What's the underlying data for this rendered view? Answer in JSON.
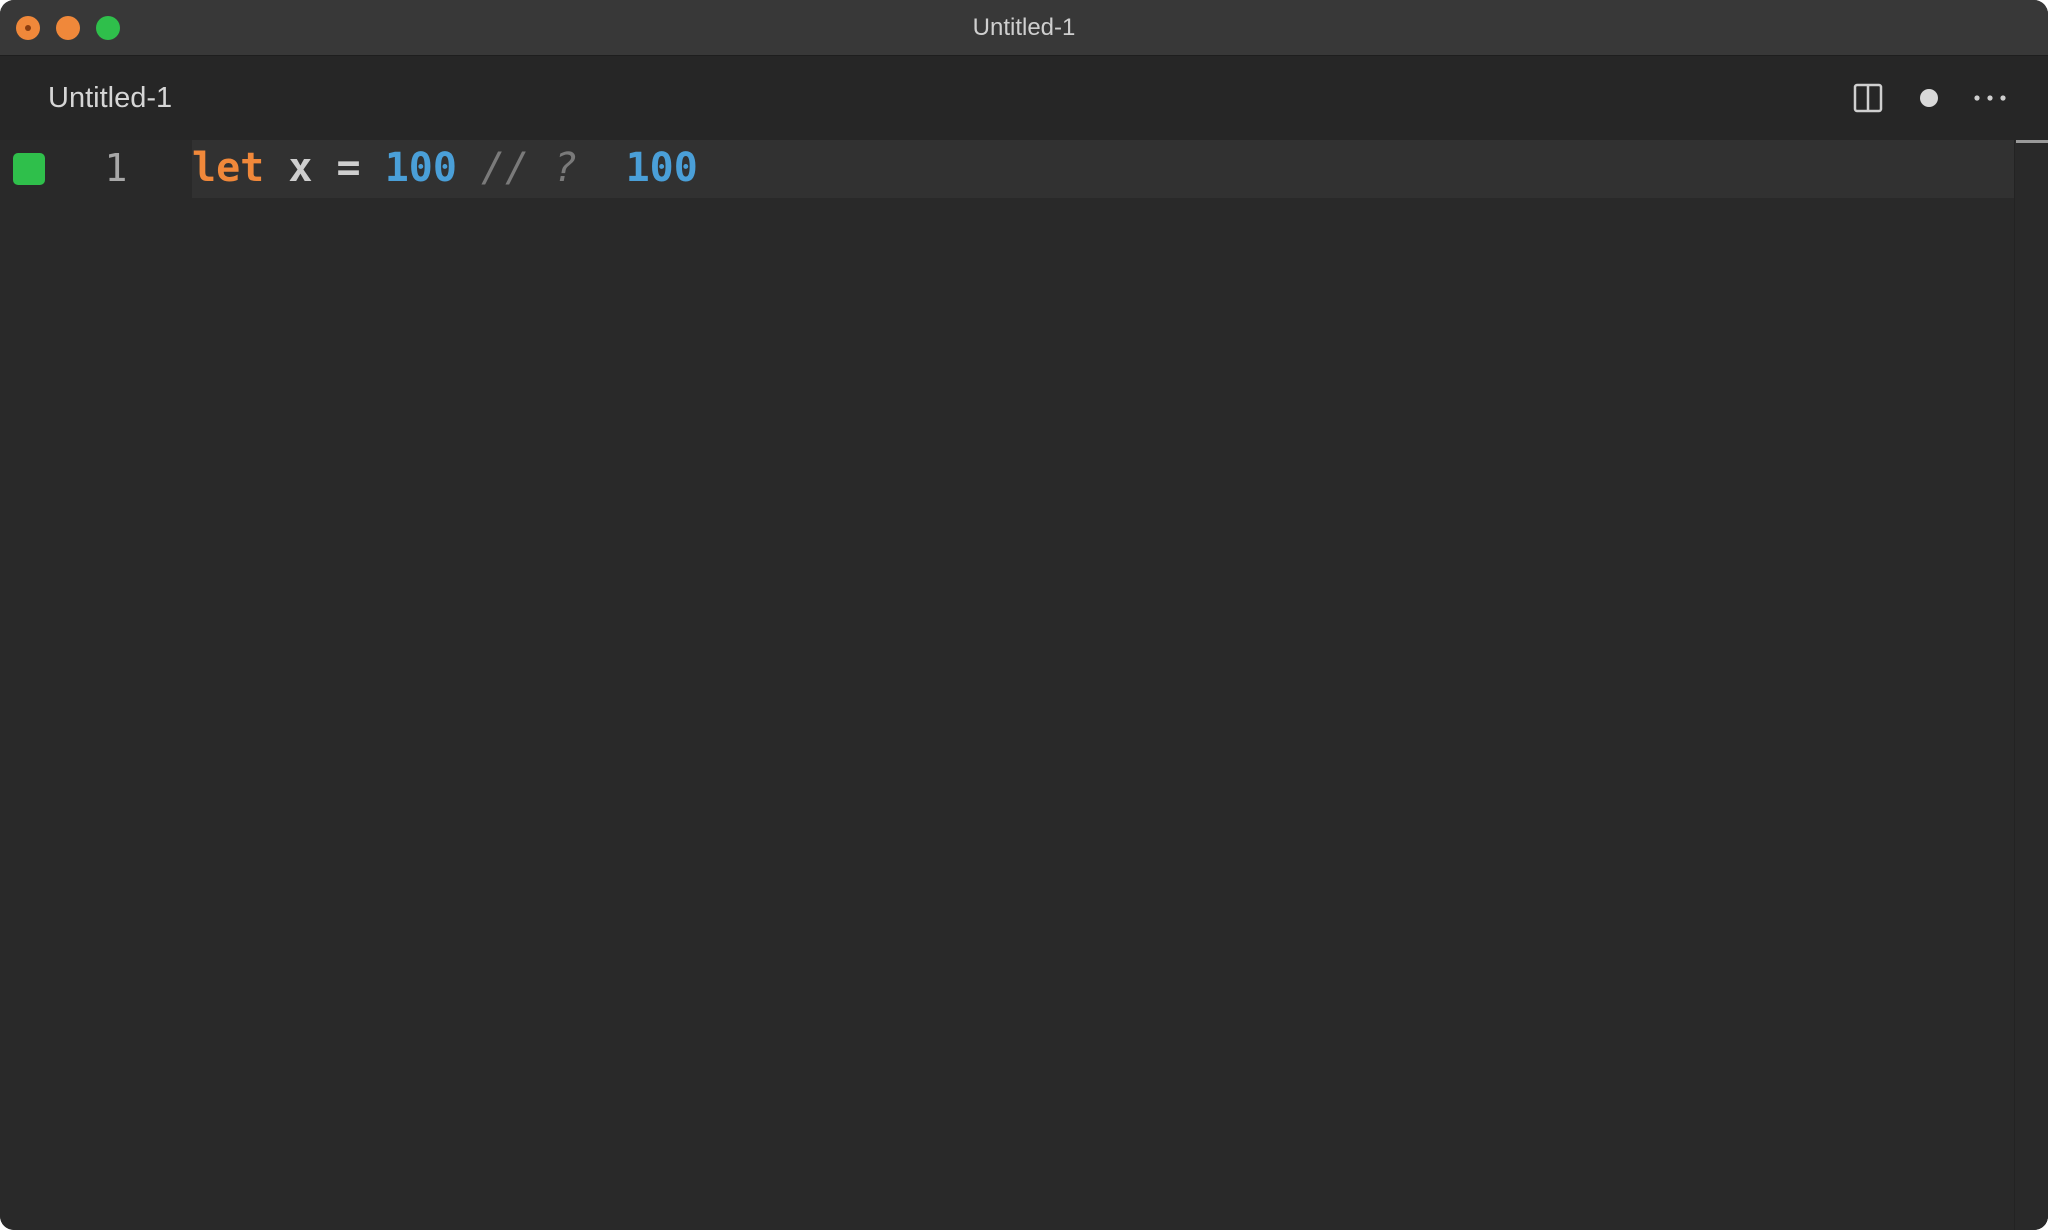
{
  "window": {
    "title": "Untitled-1"
  },
  "tab": {
    "label": "Untitled-1"
  },
  "icons": {
    "split": "split-editor-icon",
    "dirty": "unsaved-dot-icon",
    "more": "more-actions-icon"
  },
  "editor": {
    "line_number": "1",
    "tokens": {
      "keyword": "let",
      "identifier": "x",
      "operator": "=",
      "number": "100",
      "comment": "// ?",
      "result": "100"
    }
  },
  "colors": {
    "keyword": "#f0883a",
    "number": "#4a9fd8",
    "marker": "#2fbf4b",
    "background": "#292929"
  }
}
